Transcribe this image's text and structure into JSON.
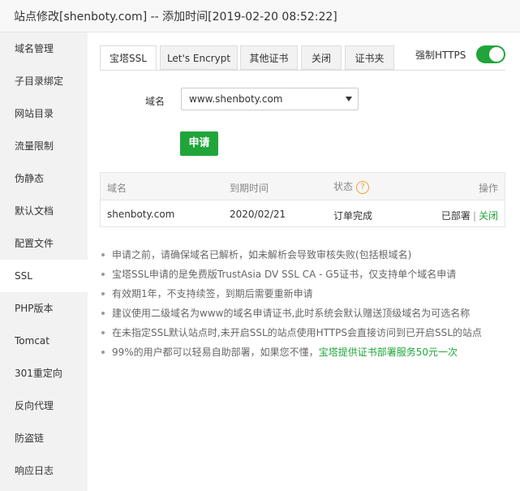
{
  "window": {
    "title": "站点修改[shenboty.com] -- 添加时间[2019-02-20 08:52:22]"
  },
  "sidebar": {
    "items": [
      {
        "label": "域名管理"
      },
      {
        "label": "子目录绑定"
      },
      {
        "label": "网站目录"
      },
      {
        "label": "流量限制"
      },
      {
        "label": "伪静态"
      },
      {
        "label": "默认文档"
      },
      {
        "label": "配置文件"
      },
      {
        "label": "SSL",
        "active": true
      },
      {
        "label": "PHP版本"
      },
      {
        "label": "Tomcat"
      },
      {
        "label": "301重定向"
      },
      {
        "label": "反向代理"
      },
      {
        "label": "防盗链"
      },
      {
        "label": "响应日志"
      }
    ]
  },
  "tabs": [
    {
      "label": "宝塔SSL",
      "active": true
    },
    {
      "label": "Let's Encrypt"
    },
    {
      "label": "其他证书"
    },
    {
      "label": "关闭"
    },
    {
      "label": "证书夹"
    }
  ],
  "force_https": {
    "label": "强制HTTPS",
    "enabled": true
  },
  "domain_form": {
    "label": "域名",
    "selected": "www.shenboty.com",
    "apply_label": "申请"
  },
  "cert_table": {
    "headers": [
      "域名",
      "到期时间",
      "状态",
      "操作"
    ],
    "rows": [
      {
        "domain": "shenboty.com",
        "expiry": "2020/02/21",
        "status": "订单完成",
        "deployed": "已部署",
        "separator": "|",
        "close": "关闭"
      }
    ]
  },
  "notes": [
    "申请之前，请确保域名已解析，如未解析会导致审核失败(包括根域名)",
    "宝塔SSL申请的是免费版TrustAsia DV SSL CA - G5证书，仅支持单个域名申请",
    "有效期1年，不支持续签，到期后需要重新申请",
    "建议使用二级域名为www的域名申请证书,此时系统会默认赠送顶级域名为可选名称",
    "在未指定SSL默认站点时,未开启SSL的站点使用HTTPS会直接访问到已开启SSL的站点"
  ],
  "last_note": {
    "text": "99%的用户都可以轻易自助部署，如果您不懂，",
    "link": "宝塔提供证书部署服务50元一次"
  },
  "icons": {
    "help": "question-circle-icon",
    "dropdown": "caret-down-icon"
  },
  "colors": {
    "accent": "#20a53a",
    "warning": "#f0a32a"
  }
}
